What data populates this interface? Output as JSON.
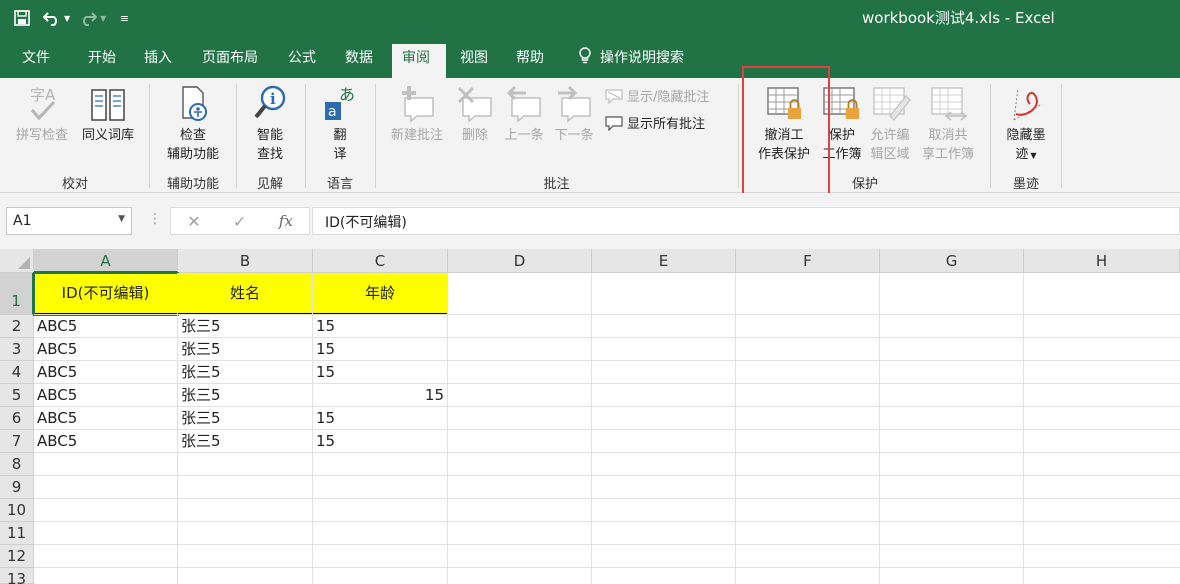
{
  "window": {
    "title": "workbook测试4.xls  -  Excel"
  },
  "quick_access": {
    "save_icon": "save-icon",
    "undo_icon": "undo-icon",
    "redo_icon": "redo-icon",
    "customize_icon": "customize-icon"
  },
  "tabs": [
    {
      "label": "文件"
    },
    {
      "label": "开始"
    },
    {
      "label": "插入"
    },
    {
      "label": "页面布局"
    },
    {
      "label": "公式"
    },
    {
      "label": "数据"
    },
    {
      "label": "审阅"
    },
    {
      "label": "视图"
    },
    {
      "label": "帮助"
    },
    {
      "label": "操作说明搜索"
    }
  ],
  "ribbon": {
    "proofing": {
      "spell_check": "拼写检查",
      "thesaurus": "同义词库",
      "group": "校对"
    },
    "accessibility": {
      "check_line1": "检查",
      "check_line2": "辅助功能",
      "group": "辅助功能"
    },
    "insights": {
      "smart_line1": "智能",
      "smart_line2": "查找",
      "group": "见解"
    },
    "language": {
      "translate_line1": "翻",
      "translate_line2": "译",
      "group": "语言"
    },
    "comments": {
      "new_comment": "新建批注",
      "delete": "删除",
      "previous": "上一条",
      "next": "下一条",
      "show_hide": "显示/隐藏批注",
      "show_all": "显示所有批注",
      "group": "批注"
    },
    "protect": {
      "unprotect_sheet_line1": "撤消工",
      "unprotect_sheet_line2": "作表保护",
      "protect_workbook_line1": "保护",
      "protect_workbook_line2": "工作簿",
      "allow_edit_line1": "允许编",
      "allow_edit_line2": "辑区域",
      "unshare_line1": "取消共",
      "unshare_line2": "享工作簿",
      "group": "保护"
    },
    "ink": {
      "hide_ink_line1": "隐藏墨",
      "hide_ink_line2": "迹",
      "group": "墨迹"
    }
  },
  "formula_bar": {
    "name_box": "A1",
    "formula": "ID(不可编辑)",
    "fx": "fx"
  },
  "sheet": {
    "columns": [
      "A",
      "B",
      "C",
      "D",
      "E",
      "F",
      "G",
      "H"
    ],
    "rows": [
      "1",
      "2",
      "3",
      "4",
      "5",
      "6",
      "7",
      "8",
      "9",
      "10",
      "11",
      "12",
      "13"
    ],
    "header": [
      "ID(不可编辑)",
      "姓名",
      "年龄"
    ],
    "data": [
      [
        "ABC5",
        "张三5",
        "15"
      ],
      [
        "ABC5",
        "张三5",
        "15"
      ],
      [
        "ABC5",
        "张三5",
        "15"
      ],
      [
        "ABC5",
        "张三5",
        "15"
      ],
      [
        "ABC5",
        "张三5",
        "15"
      ],
      [
        "ABC5",
        "张三5",
        "15"
      ]
    ],
    "header_fill": "#ffff00",
    "accent": "#217346"
  }
}
